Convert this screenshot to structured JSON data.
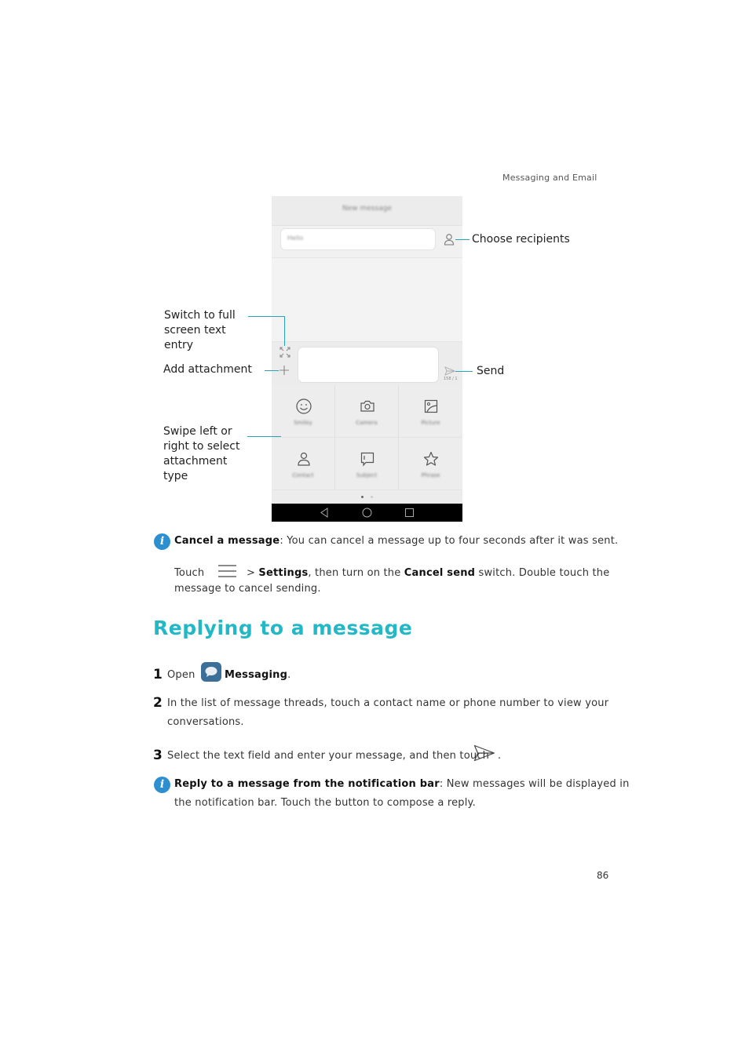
{
  "header": {
    "section": "Messaging and Email"
  },
  "phone": {
    "title": "New message",
    "recipient_placeholder": "Hello",
    "char_counter": "158 / 1",
    "attachments": [
      {
        "icon": "smiley-icon",
        "label": "Smiley"
      },
      {
        "icon": "camera-icon",
        "label": "Camera"
      },
      {
        "icon": "picture-icon",
        "label": "Picture"
      },
      {
        "icon": "contact-icon",
        "label": "Contact"
      },
      {
        "icon": "subject-icon",
        "label": "Subject"
      },
      {
        "icon": "star-icon",
        "label": "Phrase"
      }
    ],
    "page_dots": 2,
    "active_dot": 1
  },
  "callouts": {
    "choose_recipients": "Choose recipients",
    "full_screen": [
      "Switch to full",
      "screen text",
      "entry"
    ],
    "add_attachment": "Add attachment",
    "send": "Send",
    "swipe": [
      "Swipe left or",
      "right to select",
      "attachment",
      "type"
    ]
  },
  "note1": {
    "title": "Cancel a message",
    "text": ": You can cancel a message up to four seconds after it was sent.",
    "line2_touch": "Touch",
    "line2_sep": " > ",
    "line2_settings": "Settings",
    "line2_mid": ", then turn on the ",
    "line2_cancel_send": "Cancel send",
    "line2_end": " switch. Double touch the",
    "line3": "message to cancel sending."
  },
  "section_title": "Replying to a message",
  "steps": [
    {
      "num": "1",
      "pre": "Open",
      "bold": "Messaging",
      "post": "."
    },
    {
      "num": "2",
      "line1": "In the list of message threads, touch a contact name or phone number to view your",
      "line2": "conversations."
    },
    {
      "num": "3",
      "text": "Select the text field and enter your message, and then touch",
      "post": "."
    }
  ],
  "note2": {
    "title": "Reply to a message from the notification bar",
    "text": ": New messages will be displayed in",
    "line2": "the notification bar. Touch the button to compose a reply."
  },
  "page_number": "86",
  "colors": {
    "accent": "#22b8c6",
    "info": "#2d8fd0",
    "callout_line": "#2aa3b2"
  }
}
